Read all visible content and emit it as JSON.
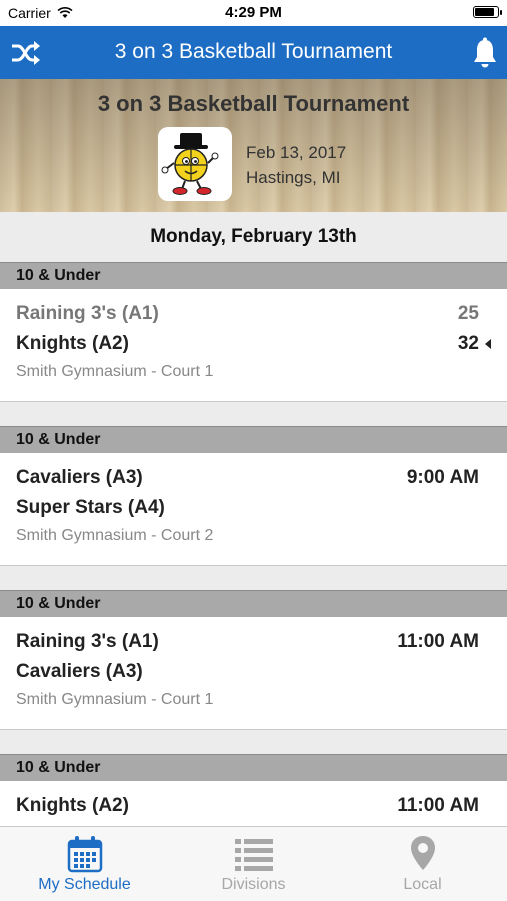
{
  "status_bar": {
    "carrier": "Carrier",
    "time": "4:29 PM"
  },
  "nav": {
    "title": "3 on 3 Basketball Tournament",
    "left_icon": "shuffle-icon",
    "right_icon": "bell-icon",
    "color": "#1d6dc4"
  },
  "banner": {
    "title": "3 on 3 Basketball Tournament",
    "date": "Feb 13, 2017",
    "location": "Hastings, MI"
  },
  "schedule": {
    "date_header": "Monday, February 13th",
    "games": [
      {
        "division": "10 & Under",
        "team1": "Raining 3's (A1)",
        "team2": "Knights (A2)",
        "score1": "25",
        "score2": "32",
        "location": "Smith Gymnasium - Court 1"
      },
      {
        "division": "10 & Under",
        "team1": "Cavaliers (A3)",
        "team2": "Super Stars (A4)",
        "time": "9:00 AM",
        "location": "Smith Gymnasium - Court 2"
      },
      {
        "division": "10 & Under",
        "team1": "Raining 3's (A1)",
        "team2": "Cavaliers (A3)",
        "time": "11:00 AM",
        "location": "Smith Gymnasium - Court 1"
      },
      {
        "division": "10 & Under",
        "team1": "Knights (A2)",
        "time": "11:00 AM"
      }
    ]
  },
  "tabs": [
    {
      "label": "My Schedule",
      "icon": "calendar-icon",
      "active": true
    },
    {
      "label": "Divisions",
      "icon": "list-icon",
      "active": false
    },
    {
      "label": "Local",
      "icon": "location-pin-icon",
      "active": false
    }
  ]
}
